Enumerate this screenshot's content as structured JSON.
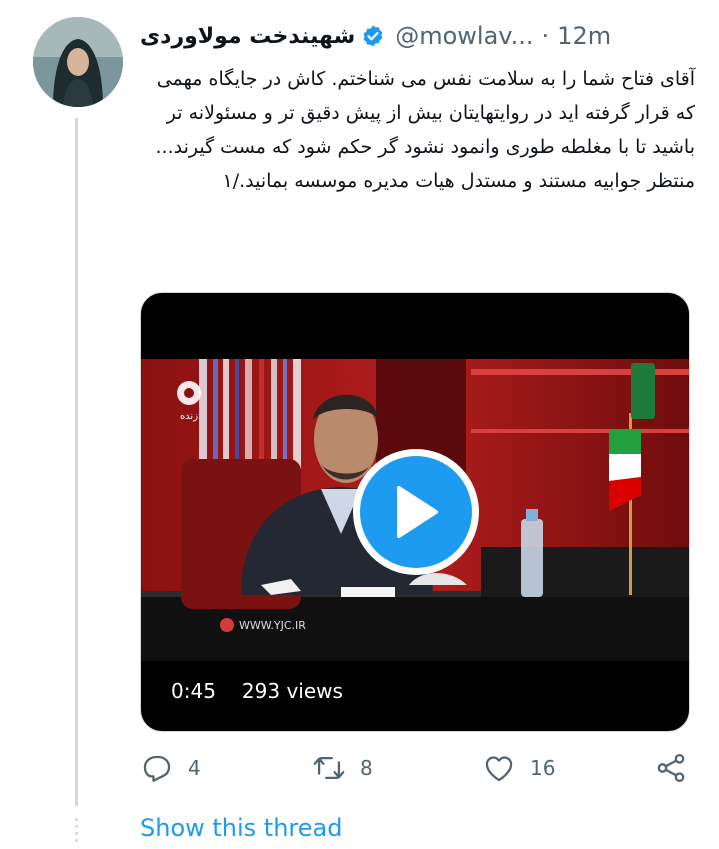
{
  "tweet": {
    "display_name": "شهیندخت مولاوردی",
    "handle": "@mowlav...",
    "separator": "·",
    "time": "12m",
    "text": "آقای فتاح شما را به سلامت نفس می شناختم. کاش در جایگاه مهمی که قرار گرفته اید در روایتهایتان بیش از پیش دقیق تر و مسئولانه تر باشید تا با مغلطه طوری وانمود نشود گر حکم شود که مست گیرند...\nمنتظر جوابیه مستند و مستدل هیات مدیره موسسه بمانید./۱"
  },
  "video": {
    "duration": "0:45",
    "views": "293 views",
    "channel_label": "زنده",
    "watermark": "WWW.YJC.IR"
  },
  "actions": {
    "reply_count": "4",
    "retweet_count": "8",
    "like_count": "16"
  },
  "show_thread_label": "Show this thread",
  "colors": {
    "accent": "#1d9bf0",
    "muted": "#536471",
    "thread_line": "#cfd9de"
  },
  "icons": {
    "verified": "verified-badge-icon",
    "play": "play-icon",
    "reply": "reply-icon",
    "retweet": "retweet-icon",
    "like": "heart-icon",
    "share": "share-icon"
  }
}
